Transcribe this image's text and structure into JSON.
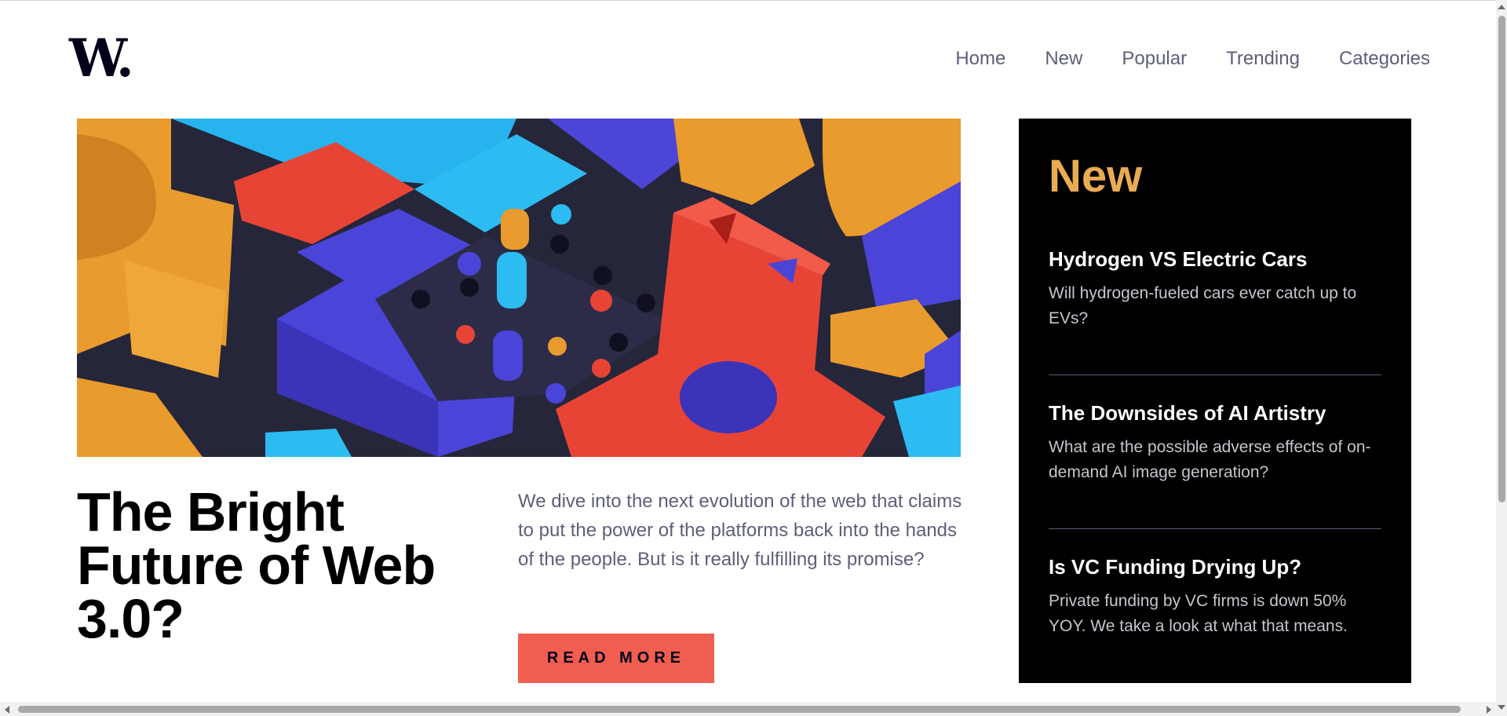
{
  "header": {
    "logo": "W.",
    "nav": [
      "Home",
      "New",
      "Popular",
      "Trending",
      "Categories"
    ]
  },
  "hero": {
    "image_icon": "abstract-3d-blocks-image",
    "title": "The Bright Future of Web 3.0?",
    "description": "We dive into the next evolution of the web that claims to put the power of the platforms back into the hands of the people. But is it really fulfilling its promise?",
    "cta_label": "Read More"
  },
  "sidebar": {
    "title": "New",
    "items": [
      {
        "title": "Hydrogen VS Electric Cars",
        "text": "Will hydrogen-fueled cars ever catch up to EVs?"
      },
      {
        "title": "The Downsides of AI Artistry",
        "text": "What are the possible adverse effects of on-demand AI image generation?"
      },
      {
        "title": "Is VC Funding Drying Up?",
        "text": "Private funding by VC firms is down 50% YOY. We take a look at what that means."
      }
    ]
  },
  "colors": {
    "accent": "#f15e50",
    "panel_title": "#e9ab53",
    "text_muted": "#5d5f79",
    "panel_bg": "#000000"
  }
}
